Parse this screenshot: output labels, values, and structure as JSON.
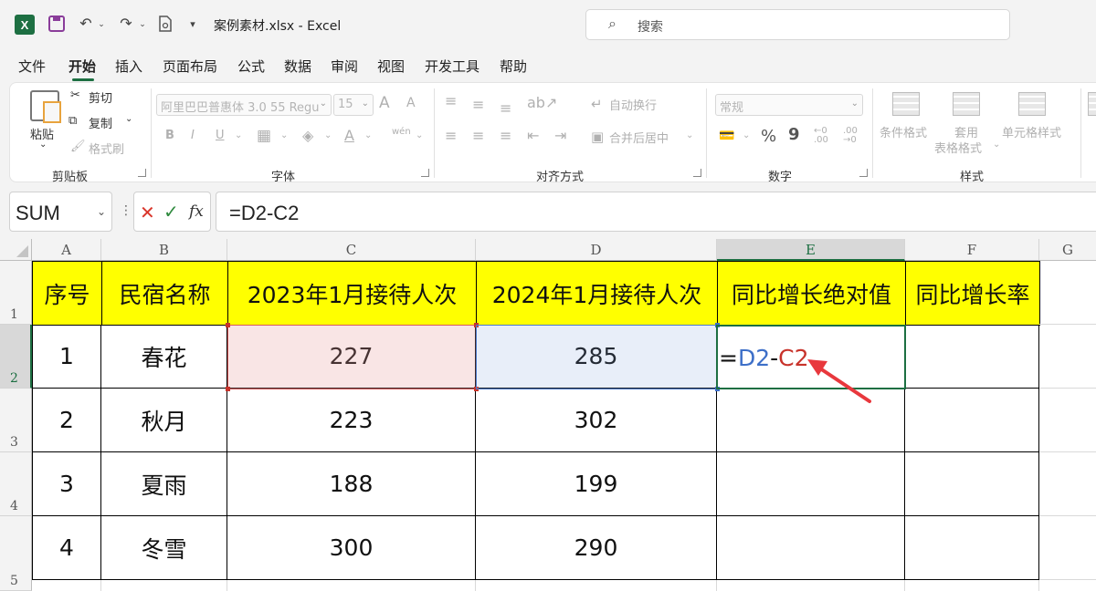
{
  "title_bar": {
    "app_logo": "X",
    "doc_title": "案例素材.xlsx  -  Excel",
    "search_placeholder": "搜索"
  },
  "menu": {
    "tabs": [
      "文件",
      "开始",
      "插入",
      "页面布局",
      "公式",
      "数据",
      "审阅",
      "视图",
      "开发工具",
      "帮助"
    ],
    "active_tab": "开始"
  },
  "ribbon": {
    "clipboard": {
      "paste": "粘贴",
      "cut": "剪切",
      "copy": "复制",
      "format_painter": "格式刷",
      "group": "剪贴板"
    },
    "font": {
      "font_name": "阿里巴巴普惠体 3.0 55 Regu",
      "font_size": "15",
      "bold": "B",
      "italic": "I",
      "underline": "U",
      "font_color": "A",
      "grow": "A",
      "shrink": "A",
      "phonetic": "wén",
      "group": "字体"
    },
    "alignment": {
      "wrap_text": "自动换行",
      "merge_center": "合并后居中",
      "group": "对齐方式"
    },
    "number": {
      "format": "常规",
      "percent": "%",
      "comma": "9",
      "group": "数字"
    },
    "styles": {
      "conditional_formatting": "条件格式",
      "format_as_table_line1": "套用",
      "format_as_table_line2": "表格格式",
      "cell_styles": "单元格样式",
      "group": "样式"
    }
  },
  "formula_bar": {
    "name_box": "SUM",
    "formula": "=D2-C2",
    "fx": "fx"
  },
  "sheet": {
    "columns": [
      "A",
      "B",
      "C",
      "D",
      "E",
      "F",
      "G"
    ],
    "rows": [
      "1",
      "2",
      "3",
      "4",
      "5"
    ],
    "selected_column": "E",
    "selected_row": "2",
    "headers": [
      "序号",
      "民宿名称",
      "2023年1月接待人次",
      "2024年1月接待人次",
      "同比增长绝对值",
      "同比增长率"
    ],
    "data": [
      {
        "no": "1",
        "name": "春花",
        "y2023": "227",
        "y2024": "285"
      },
      {
        "no": "2",
        "name": "秋月",
        "y2023": "223",
        "y2024": "302"
      },
      {
        "no": "3",
        "name": "夏雨",
        "y2023": "188",
        "y2024": "199"
      },
      {
        "no": "4",
        "name": "冬雪",
        "y2023": "300",
        "y2024": "290"
      }
    ],
    "editing_cell": {
      "eq": "=",
      "ref1": "D2",
      "op": "-",
      "ref2": "C2"
    },
    "colors": {
      "header_fill": "#ffff00",
      "ref_d2": "#3d6fc8",
      "ref_c2": "#c8332b",
      "active_border": "#1d6f42",
      "arrow": "#e8383d"
    }
  }
}
